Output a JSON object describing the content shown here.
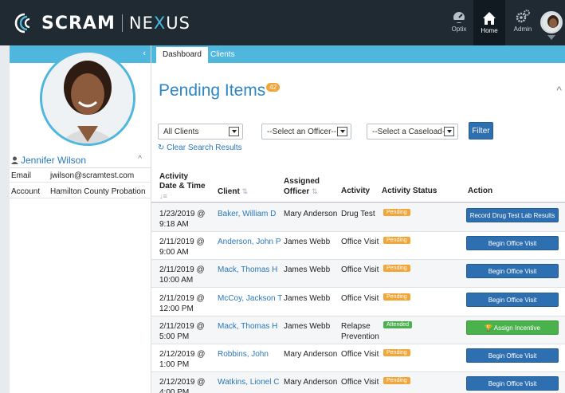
{
  "brand": {
    "name": "SCRAM",
    "product_pre": "NE",
    "product_x": "X",
    "product_post": "US"
  },
  "topnav": [
    {
      "label": "Optix",
      "icon": "gauge-icon"
    },
    {
      "label": "Home",
      "icon": "home-icon",
      "active": true
    },
    {
      "label": "Admin",
      "icon": "gears-icon"
    }
  ],
  "sidebar": {
    "user_name": "Jennifer Wilson",
    "email_label": "Email",
    "email_value": "jwilson@scramtest.com",
    "account_label": "Account",
    "account_value": "Hamilton County Probation"
  },
  "tabs": [
    {
      "label": "Dashboard",
      "active": true
    },
    {
      "label": "Clients",
      "active": false
    }
  ],
  "page": {
    "title": "Pending Items",
    "count_badge": "42"
  },
  "filters": {
    "clients": "All Clients",
    "officer": "--Select an Officer--",
    "caseload": "--Select a Caseload--",
    "filter_button": "Filter",
    "clear_link": "Clear Search Results"
  },
  "table": {
    "headers": {
      "datetime_1": "Activity",
      "datetime_2": "Date & Time",
      "client": "Client",
      "officer_1": "Assigned",
      "officer_2": "Officer",
      "activity": "Activity",
      "status": "Activity Status",
      "action": "Action"
    },
    "rows": [
      {
        "date": "1/23/2019 @",
        "time": "9:18 AM",
        "client": "Baker, William D",
        "officer": "Mary Anderson",
        "activity_1": "Drug Test",
        "activity_2": "",
        "status": "Pending",
        "action": "Record Drug Test Lab Results"
      },
      {
        "date": "2/11/2019 @",
        "time": "9:00 AM",
        "client": "Anderson, John P",
        "officer": "James Webb",
        "activity_1": "Office Visit",
        "activity_2": "",
        "status": "Pending",
        "action": "Begin Office Visit"
      },
      {
        "date": "2/11/2019 @",
        "time": "10:00 AM",
        "client": "Mack, Thomas H",
        "officer": "James Webb",
        "activity_1": "Office Visit",
        "activity_2": "",
        "status": "Pending",
        "action": "Begin Office Visit"
      },
      {
        "date": "2/11/2019 @",
        "time": "12:00 PM",
        "client": "McCoy, Jackson T",
        "officer": "James Webb",
        "activity_1": "Office Visit",
        "activity_2": "",
        "status": "Pending",
        "action": "Begin Office Visit"
      },
      {
        "date": "2/11/2019 @",
        "time": "5:00 PM",
        "client": "Mack, Thomas H",
        "officer": "James Webb",
        "activity_1": "Relapse",
        "activity_2": "Prevention",
        "status": "Attended",
        "action": "Assign Incentive"
      },
      {
        "date": "2/12/2019 @",
        "time": "1:00 PM",
        "client": "Robbins, John",
        "officer": "Mary Anderson",
        "activity_1": "Office Visit",
        "activity_2": "",
        "status": "Pending",
        "action": "Begin Office Visit"
      },
      {
        "date": "2/12/2019 @",
        "time": "4:00 PM",
        "client": "Watkins, Lionel C",
        "officer": "Mary Anderson",
        "activity_1": "Office Visit",
        "activity_2": "",
        "status": "Pending",
        "action": "Begin Office Visit"
      }
    ]
  },
  "colors": {
    "accent": "#4fb6dd",
    "link": "#2a77b8",
    "pending": "#f2a63a",
    "attended": "#4caf50",
    "button": "#2d6fb0"
  }
}
